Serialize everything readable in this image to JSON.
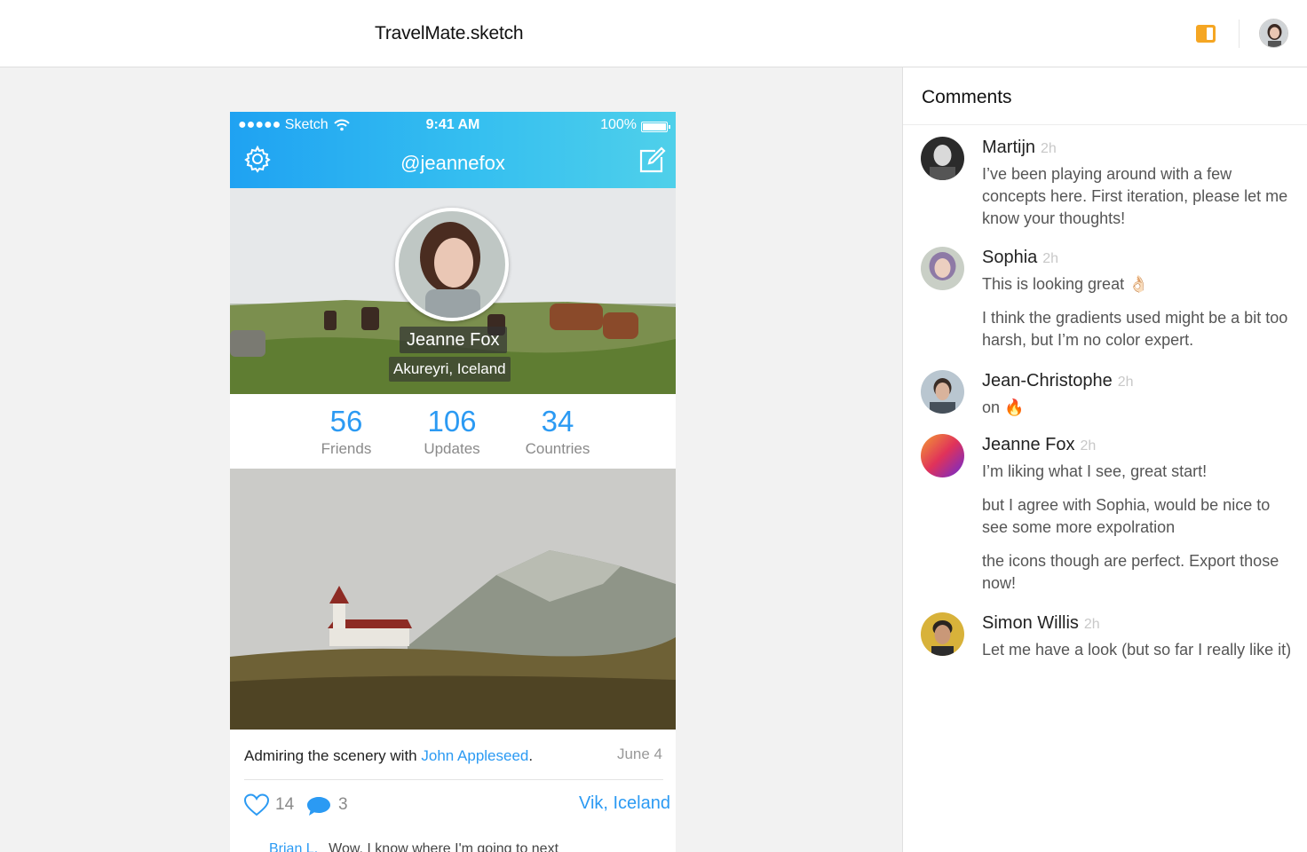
{
  "window": {
    "title": "TravelMate.sketch"
  },
  "phone": {
    "status": {
      "carrier": "●●●●● Sketch",
      "time": "9:41 AM",
      "battery": "100%"
    },
    "nav_title": "@jeannefox",
    "profile": {
      "name": "Jeanne Fox",
      "location": "Akureyri, Iceland"
    },
    "stats": [
      {
        "value": "56",
        "label": "Friends"
      },
      {
        "value": "106",
        "label": "Updates"
      },
      {
        "value": "34",
        "label": "Countries"
      }
    ],
    "post": {
      "caption_prefix": "Admiring the scenery with ",
      "caption_link": "John Appleseed",
      "caption_suffix": ".",
      "date": "June 4",
      "likes": "14",
      "comments": "3",
      "place": "Vik, Iceland",
      "next_comment_author": "Brian L.",
      "next_comment_text": "Wow, I know where I'm going to next"
    }
  },
  "comments": {
    "title": "Comments",
    "items": [
      {
        "author": "Martijn",
        "time": "2h",
        "paragraphs": [
          "I’ve been playing around with a few concepts here. First iteration, please let me know your thoughts!"
        ]
      },
      {
        "author": "Sophia",
        "time": "2h",
        "paragraphs": [
          "This is looking great 👌🏻",
          "I think the gradients used might be a bit too harsh, but I’m no color expert."
        ]
      },
      {
        "author": "Jean-Christophe",
        "time": "2h",
        "paragraphs": [
          "on 🔥"
        ]
      },
      {
        "author": "Jeanne Fox",
        "time": "2h",
        "paragraphs": [
          "I’m liking what I see, great start!",
          "but I agree with Sophia, would be nice to see some more expolration",
          "the icons though are perfect. Export those now!"
        ]
      },
      {
        "author": "Simon Willis",
        "time": "2h",
        "paragraphs": [
          "Let me have a look (but so far I really like it)"
        ]
      }
    ]
  }
}
